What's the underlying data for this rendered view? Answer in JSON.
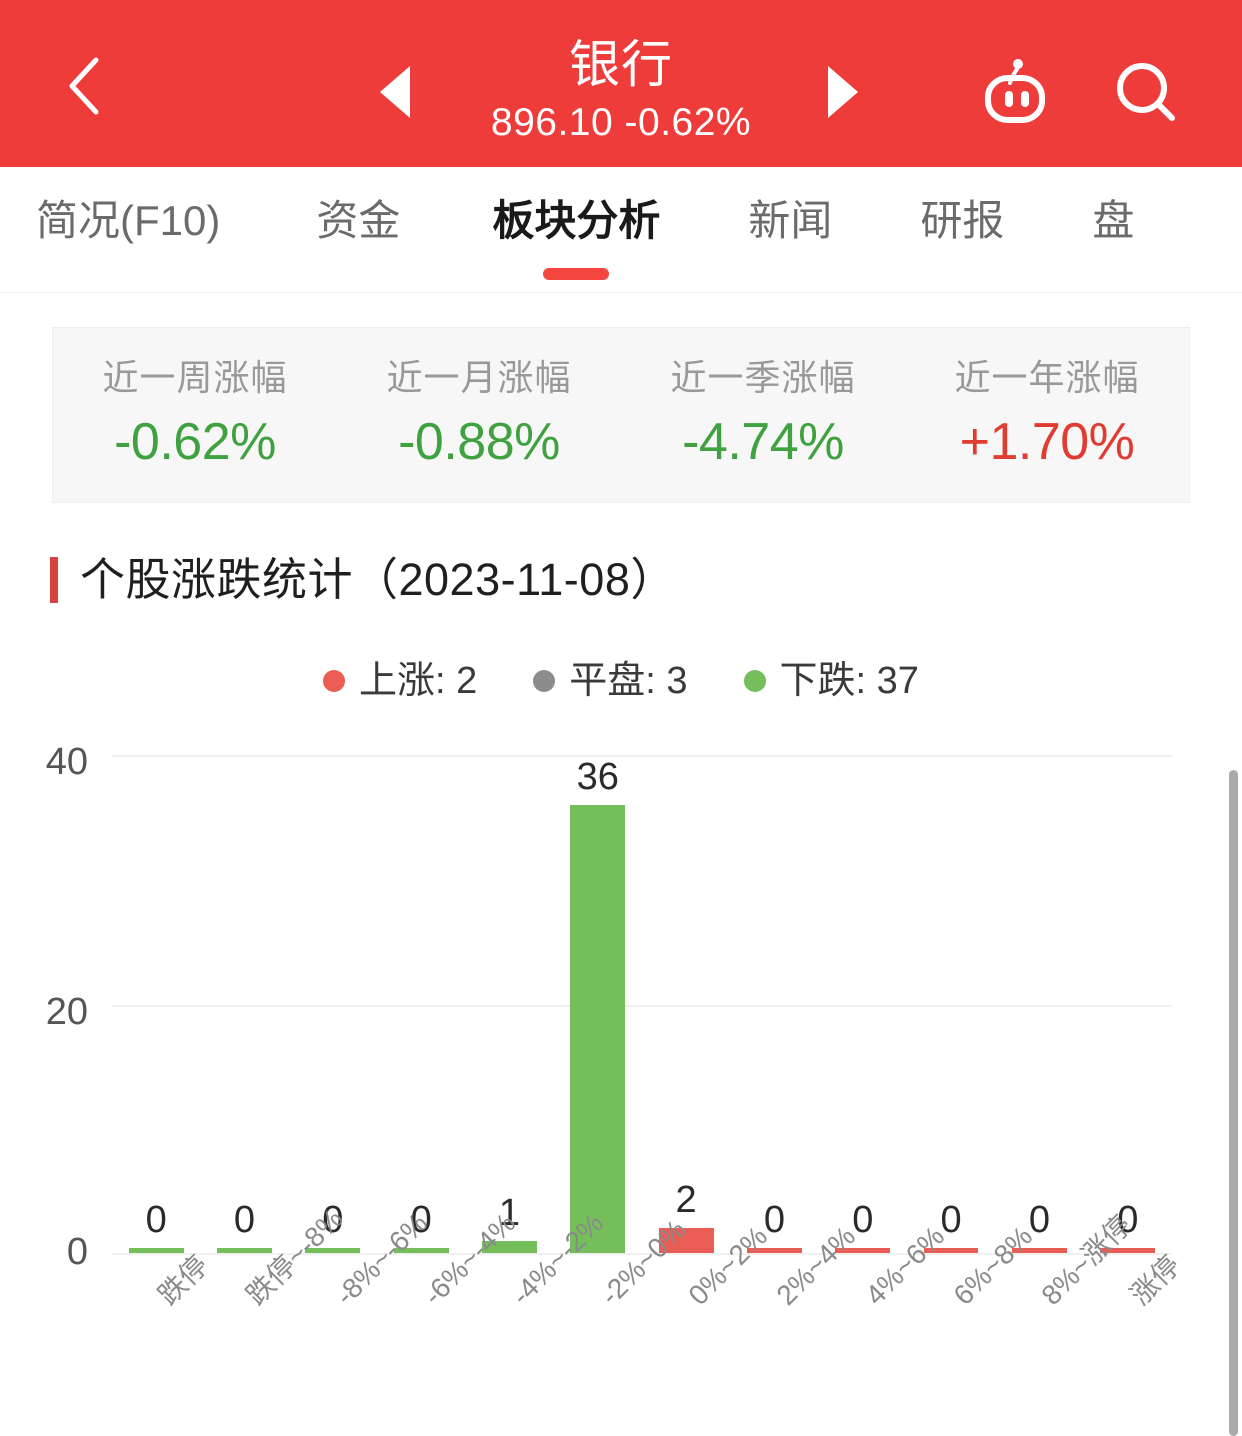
{
  "header": {
    "back_icon": "chevron-left-icon",
    "prev_icon": "triangle-left-icon",
    "next_icon": "triangle-right-icon",
    "robot_icon": "robot-icon",
    "search_icon": "search-icon",
    "sector_name": "银行",
    "price": "896.10 -0.62%",
    "bg_color": "#ee3c3a"
  },
  "tabs": {
    "items": [
      {
        "label": "简况(F10)",
        "active": false
      },
      {
        "label": "资金",
        "active": false
      },
      {
        "label": "板块分析",
        "active": true
      },
      {
        "label": "新闻",
        "active": false
      },
      {
        "label": "研报",
        "active": false
      },
      {
        "label": "盘",
        "active": false
      }
    ],
    "active_index": 2,
    "indicator_color": "#f4453f"
  },
  "stats": [
    {
      "label": "近一周涨幅",
      "value": "-0.62%",
      "tone": "down"
    },
    {
      "label": "近一月涨幅",
      "value": "-0.88%",
      "tone": "down"
    },
    {
      "label": "近一季涨幅",
      "value": "-4.74%",
      "tone": "down"
    },
    {
      "label": "近一年涨幅",
      "value": "+1.70%",
      "tone": "up"
    }
  ],
  "section": {
    "title": "个股涨跌统计（2023-11-08）",
    "accent_color": "#d9453e"
  },
  "legend": [
    {
      "label": "上涨: 2",
      "color": "#ea5d55"
    },
    {
      "label": "平盘: 3",
      "color": "#8c8c8c"
    },
    {
      "label": "下跌: 37",
      "color": "#74bf5c"
    }
  ],
  "chart_data": {
    "type": "bar",
    "title": "个股涨跌统计（2023-11-08）",
    "xlabel": "",
    "ylabel": "",
    "ylim": [
      0,
      40
    ],
    "yticks": [
      "0",
      "20",
      "40"
    ],
    "grid": true,
    "legend_position": "top-center",
    "categories": [
      "跌停",
      "跌停~-8%",
      "-8%~-6%",
      "-6%~-4%",
      "-4%~-2%",
      "-2%~0%",
      "0%~2%",
      "2%~4%",
      "4%~6%",
      "6%~8%",
      "8%~涨停",
      "涨停"
    ],
    "values": [
      0,
      0,
      0,
      0,
      1,
      36,
      2,
      0,
      0,
      0,
      0,
      0
    ],
    "bar_colors": [
      "#74bf5c",
      "#74bf5c",
      "#74bf5c",
      "#74bf5c",
      "#74bf5c",
      "#74bf5c",
      "#ea5d55",
      "#ea5d55",
      "#ea5d55",
      "#ea5d55",
      "#ea5d55",
      "#ea5d55"
    ],
    "data_labels": [
      "0",
      "0",
      "0",
      "0",
      "1",
      "36",
      "2",
      "0",
      "0",
      "0",
      "0",
      "0"
    ],
    "series": [
      {
        "name": "下跌",
        "color": "#74bf5c",
        "values": [
          0,
          0,
          0,
          0,
          1,
          36,
          null,
          null,
          null,
          null,
          null,
          null
        ]
      },
      {
        "name": "上涨",
        "color": "#ea5d55",
        "values": [
          null,
          null,
          null,
          null,
          null,
          null,
          2,
          0,
          0,
          0,
          0,
          0
        ]
      }
    ],
    "summary": {
      "上涨": 2,
      "平盘": 3,
      "下跌": 37
    }
  },
  "scrollbar": {
    "name": "page-scrollbar"
  }
}
